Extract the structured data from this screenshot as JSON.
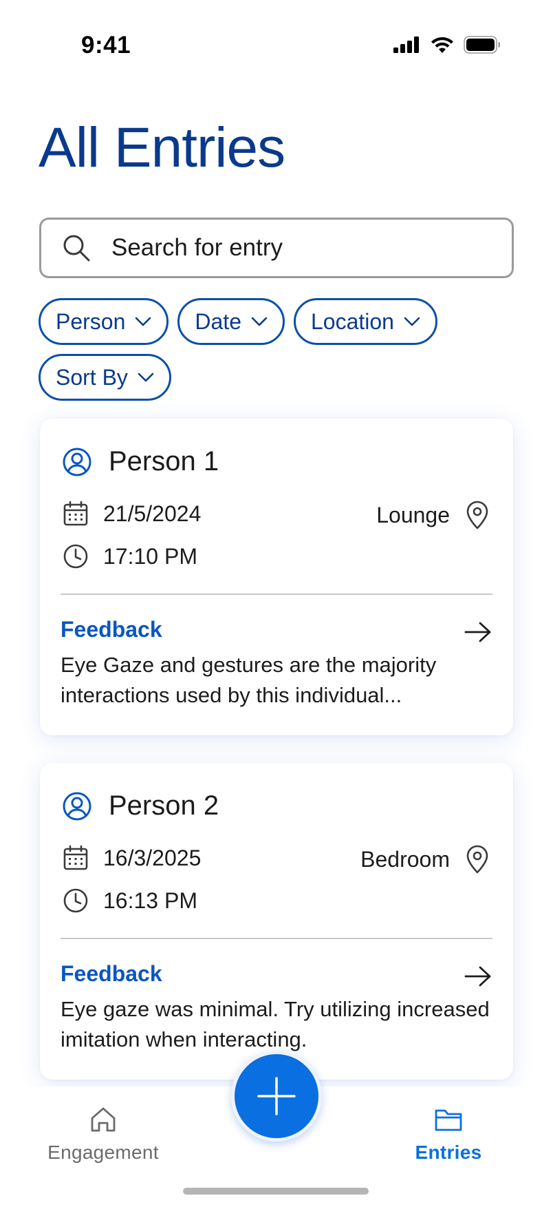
{
  "status_bar": {
    "time": "9:41",
    "icons": [
      "cellular-signal-icon",
      "wifi-icon",
      "battery-icon"
    ]
  },
  "page": {
    "title": "All Entries"
  },
  "search": {
    "placeholder": "Search for entry",
    "icon": "search-icon"
  },
  "filters": [
    {
      "label": "Person",
      "icon": "chevron-down-icon"
    },
    {
      "label": "Date",
      "icon": "chevron-down-icon"
    },
    {
      "label": "Location",
      "icon": "chevron-down-icon"
    },
    {
      "label": "Sort By",
      "icon": "chevron-down-icon"
    }
  ],
  "entries": [
    {
      "person": "Person 1",
      "date": "21/5/2024",
      "time": "17:10 PM",
      "location": "Lounge",
      "feedback_label": "Feedback",
      "feedback_text": "Eye Gaze and gestures are the majority interactions used by this individual..."
    },
    {
      "person": "Person 2",
      "date": "16/3/2025",
      "time": "16:13 PM",
      "location": "Bedroom",
      "feedback_label": "Feedback",
      "feedback_text": "Eye gaze was minimal. Try utilizing increased imitation when interacting."
    }
  ],
  "bottom_nav": {
    "items": [
      {
        "label": "Engagement",
        "icon": "home-icon",
        "active": false
      },
      {
        "label": "Entries",
        "icon": "folder-icon",
        "active": true
      }
    ],
    "fab_icon": "plus-icon"
  },
  "colors": {
    "title": "#0a3a8c",
    "accent": "#0a6fe0",
    "chip_border": "#0a4fa8",
    "feedback": "#0a56c2"
  }
}
